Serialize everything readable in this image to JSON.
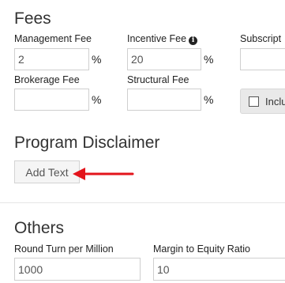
{
  "fees": {
    "title": "Fees",
    "management_fee": {
      "label": "Management Fee",
      "value": "2",
      "unit": "%"
    },
    "incentive_fee": {
      "label": "Incentive Fee",
      "value": "20",
      "unit": "%",
      "icon": "info-icon"
    },
    "subscription": {
      "label": "Subscript",
      "value": ""
    },
    "brokerage_fee": {
      "label": "Brokerage Fee",
      "value": "",
      "unit": "%"
    },
    "structural_fee": {
      "label": "Structural Fee",
      "value": "",
      "unit": "%"
    },
    "include_checkbox": {
      "label": "Inclu",
      "checked": false
    }
  },
  "program_disclaimer": {
    "title": "Program Disclaimer",
    "add_text_label": "Add Text",
    "annotation_arrow_color": "#e3141b"
  },
  "others": {
    "title": "Others",
    "round_turn_per_million": {
      "label": "Round Turn per Million",
      "value": "1000"
    },
    "margin_to_equity_ratio": {
      "label": "Margin to Equity Ratio",
      "value": "10"
    }
  }
}
